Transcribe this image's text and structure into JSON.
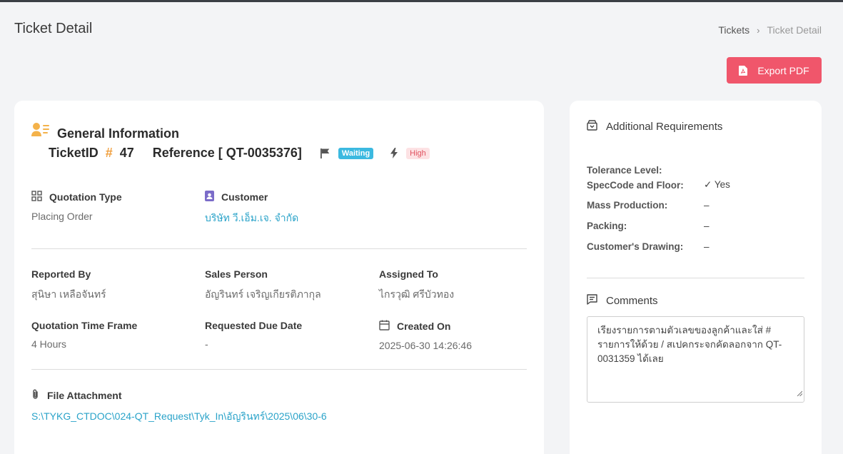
{
  "header": {
    "title": "Ticket Detail",
    "breadcrumb": {
      "parent": "Tickets",
      "separator": "›",
      "current": "Ticket Detail"
    },
    "export_label": "Export PDF"
  },
  "general": {
    "title": "General Information",
    "ticket_id_label": "TicketID",
    "hash": "#",
    "ticket_id": "47",
    "reference": "Reference [ QT-0035376]",
    "status_badge": "Waiting",
    "priority_badge": "High"
  },
  "fields": {
    "quotation_type": {
      "label": "Quotation Type",
      "value": "Placing Order"
    },
    "customer": {
      "label": "Customer",
      "value": "บริษัท วี.เอ็ม.เจ. จำกัด"
    },
    "reported_by": {
      "label": "Reported By",
      "value": "สุนิษา เหลือจันทร์"
    },
    "sales_person": {
      "label": "Sales Person",
      "value": "อัญรินทร์ เจริญเกียรติภากุล"
    },
    "assigned_to": {
      "label": "Assigned To",
      "value": "ไกรวุฒิ ศรีบัวทอง"
    },
    "time_frame": {
      "label": "Quotation Time Frame",
      "value": "4 Hours"
    },
    "due_date": {
      "label": "Requested Due Date",
      "value": "-"
    },
    "created_on": {
      "label": "Created On",
      "value": "2025-06-30 14:26:46"
    },
    "attachment": {
      "label": "File Attachment",
      "value": "S:\\TYKG_CTDOC\\024-QT_Request\\Tyk_In\\อัญรินทร์\\2025\\06\\30-6"
    }
  },
  "additional": {
    "title": "Additional Requirements",
    "items": [
      {
        "label": "Tolerance Level:",
        "value": ""
      },
      {
        "label": "SpecCode and Floor:",
        "value": "✓ Yes"
      },
      {
        "label": "Mass Production:",
        "value": "–"
      },
      {
        "label": "Packing:",
        "value": "–"
      },
      {
        "label": "Customer's Drawing:",
        "value": "–"
      }
    ]
  },
  "comments": {
    "title": "Comments",
    "text": "เรียงรายการตามตัวเลขของลูกค้าและใส่ # รายการให้ด้วย / สเปคกระจกคัดลอกจาก QT-0031359 ได้เลย"
  },
  "colors": {
    "export_button": "#f0566b",
    "accent_orange": "#f0a040",
    "link": "#2aa3c9",
    "badge_waiting": "#3bb9e0",
    "badge_high_bg": "#fde2e4",
    "badge_high_text": "#e0525f"
  }
}
